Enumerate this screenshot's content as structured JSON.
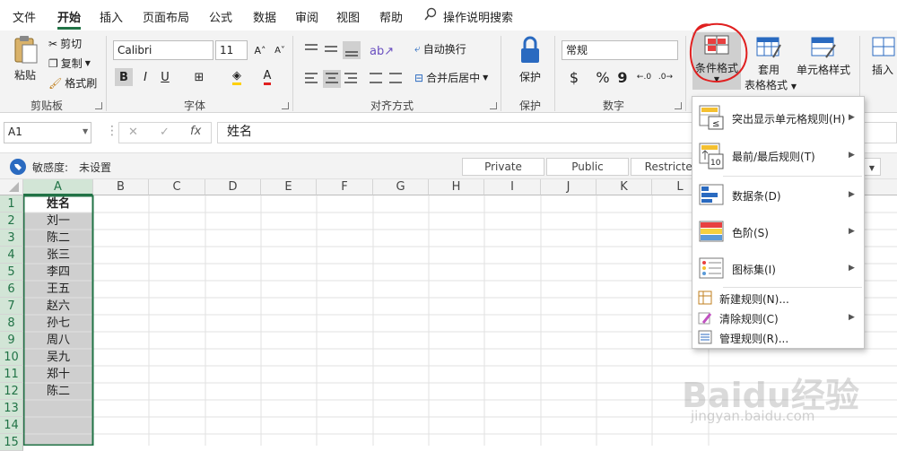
{
  "tabs": [
    "文件",
    "开始",
    "插入",
    "页面布局",
    "公式",
    "数据",
    "审阅",
    "视图",
    "帮助"
  ],
  "tell_me": "操作说明搜索",
  "clipboard": {
    "paste": "粘贴",
    "cut": "剪切",
    "copy": "复制",
    "format_painter": "格式刷",
    "group": "剪贴板"
  },
  "font": {
    "name": "Calibri",
    "size": "11",
    "bold": "B",
    "italic": "I",
    "underline": "U",
    "grow": "A˄",
    "shrink": "A˅",
    "color_a": "A",
    "highlight": "◈",
    "group": "字体"
  },
  "align": {
    "wrap": "自动换行",
    "merge": "合并后居中",
    "group": "对齐方式"
  },
  "protect": {
    "label": "保护",
    "group": "保护"
  },
  "number": {
    "format": "常规",
    "currency": "$",
    "percent": "%",
    "comma": "9",
    "group": "数字"
  },
  "styles": {
    "cond_format": "条件格式",
    "table_format_1": "套用",
    "table_format_2": "表格格式",
    "cell_styles": "单元格样式"
  },
  "cells": {
    "insert": "插入"
  },
  "formula_bar": {
    "name_box": "A1",
    "fx": "fx",
    "content": "姓名",
    "cancel": "✕",
    "enter": "✓"
  },
  "sensitivity": {
    "label": "敏感度:",
    "value": "未设置",
    "buttons": [
      "Private",
      "Public",
      "Restricted"
    ]
  },
  "columns": [
    "A",
    "B",
    "C",
    "D",
    "E",
    "F",
    "G",
    "H",
    "I",
    "J",
    "K",
    "L"
  ],
  "rows": [
    "1",
    "2",
    "3",
    "4",
    "5",
    "6",
    "7",
    "8",
    "9",
    "10",
    "11",
    "12",
    "13",
    "14",
    "15"
  ],
  "cells_a": [
    "姓名",
    "刘一",
    "陈二",
    "张三",
    "李四",
    "王五",
    "赵六",
    "孙七",
    "周八",
    "吴九",
    "郑十",
    "陈二",
    "",
    "",
    ""
  ],
  "menu": {
    "items": [
      {
        "label": "突出显示单元格规则(H)",
        "icon": "highlight-rules-icon"
      },
      {
        "label": "最前/最后规则(T)",
        "icon": "top-bottom-rules-icon"
      },
      {
        "label": "数据条(D)",
        "icon": "data-bars-icon"
      },
      {
        "label": "色阶(S)",
        "icon": "color-scales-icon"
      },
      {
        "label": "图标集(I)",
        "icon": "icon-sets-icon"
      }
    ],
    "small_items": [
      {
        "label": "新建规则(N)...",
        "icon": "new-rule-icon"
      },
      {
        "label": "清除规则(C)",
        "icon": "clear-rules-icon"
      },
      {
        "label": "管理规则(R)...",
        "icon": "manage-rules-icon"
      }
    ]
  },
  "watermark": {
    "brand": "Baidu经验",
    "url": "jingyan.baidu.com"
  },
  "colors": {
    "excel_green": "#217346",
    "annotation_red": "#e02020",
    "selection": "#cfcfcf"
  }
}
